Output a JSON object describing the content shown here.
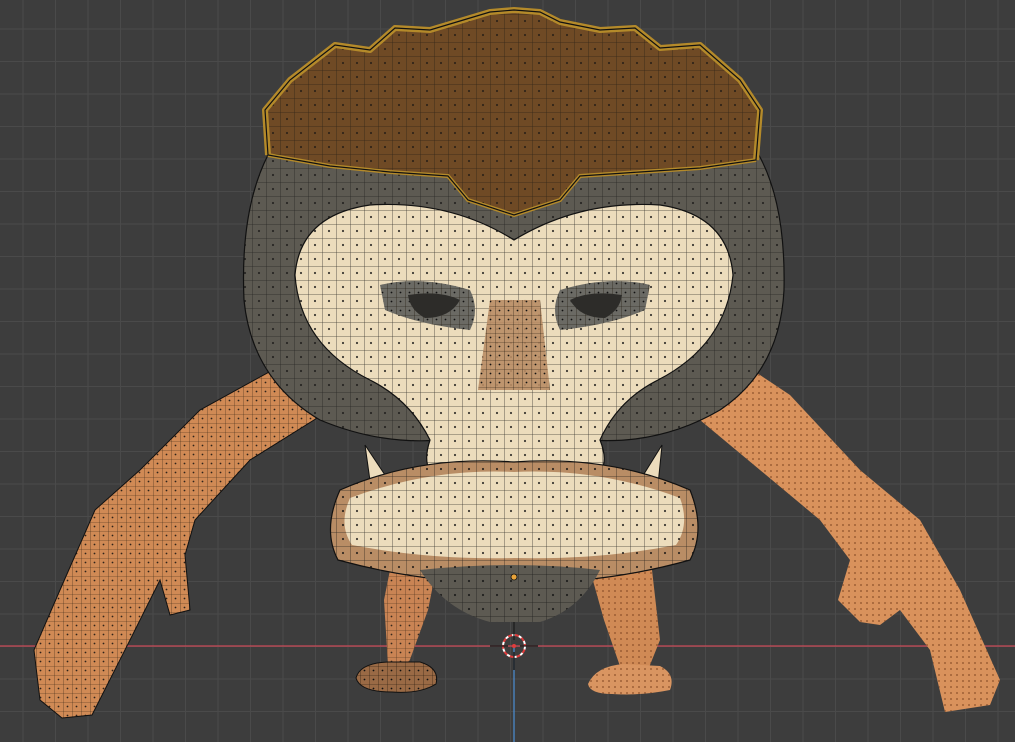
{
  "viewport": {
    "background_color": "#3d3d3d",
    "grid_color": "#4a4a4a",
    "x_axis_color": "#c94a57",
    "y_axis_color": "#4b8fd6"
  },
  "model": {
    "colors": {
      "hair": "#6f4a25",
      "hair_rim": "#b48a2a",
      "skin_dark": "#5d5a52",
      "face": "#ecdcbc",
      "nose_bridge": "#b98d65",
      "arm": "#d08a55",
      "arm_light": "#e3a16c",
      "wire": "#111111"
    }
  },
  "cursor": {
    "icon": "3d-cursor-icon"
  }
}
